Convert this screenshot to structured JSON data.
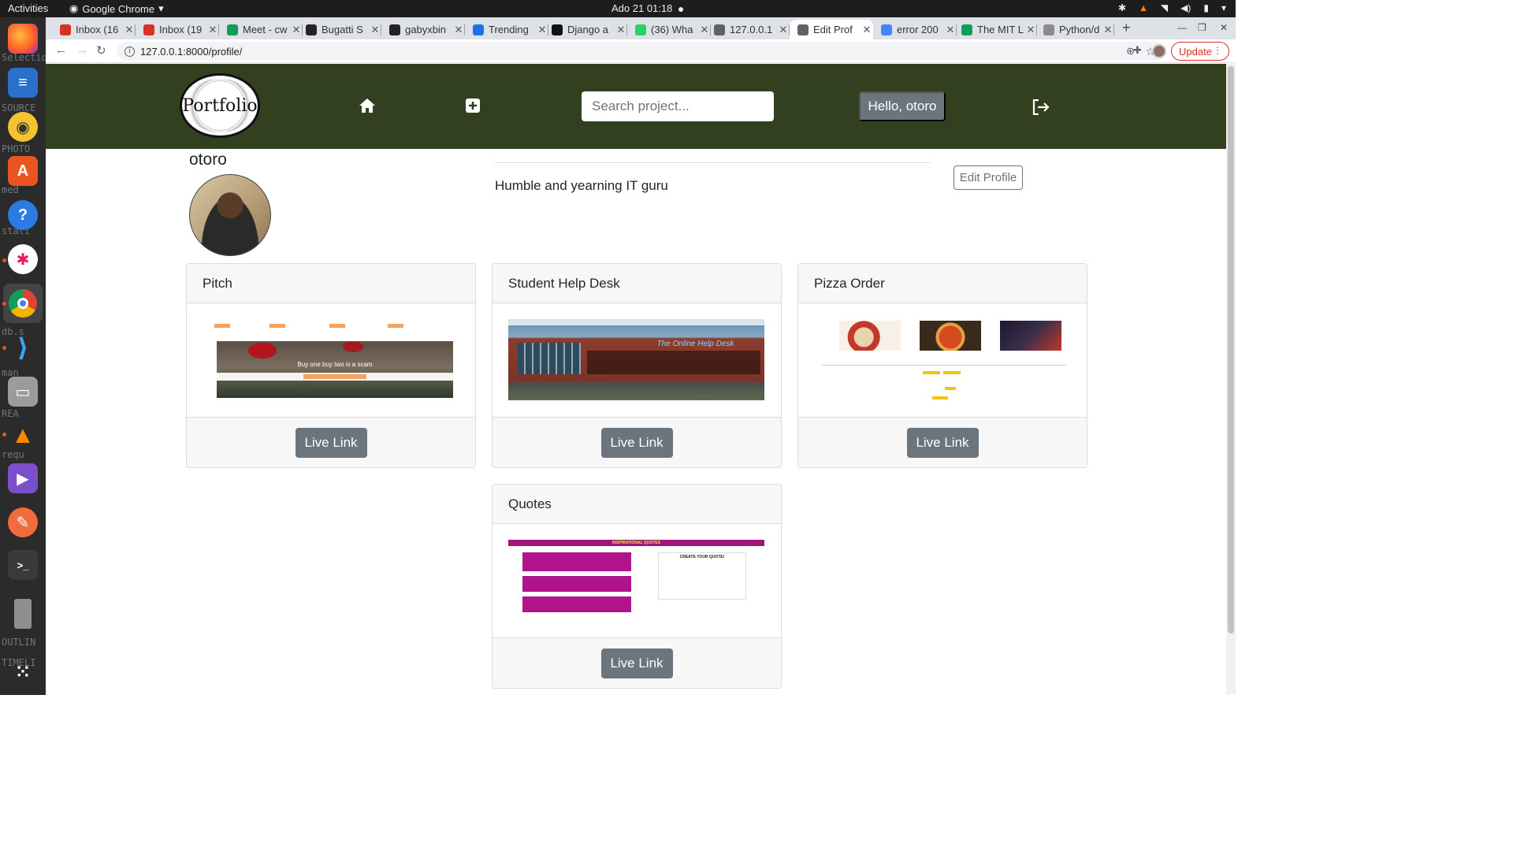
{
  "os": {
    "activities": "Activities",
    "app_name": "Google Chrome",
    "clock": "Ado 21  01:18"
  },
  "dock_ghost_text": [
    "Selection",
    "SOURCE",
    "PHOTO",
    "med",
    "stati",
    "db.s",
    "man",
    "REA",
    "requ",
    "OUTLIN",
    "TIMELI"
  ],
  "browser": {
    "tabs": [
      {
        "title": "Inbox (16",
        "favicon": "gmail-icon",
        "color": "#d93025"
      },
      {
        "title": "Inbox (19",
        "favicon": "gmail-icon",
        "color": "#d93025"
      },
      {
        "title": "Meet - cw",
        "favicon": "meet-icon",
        "color": "#0f9d58"
      },
      {
        "title": "Bugatti S",
        "favicon": "wikipedia-icon",
        "color": "#222222"
      },
      {
        "title": "gabyxbin",
        "favicon": "github-icon",
        "color": "#222222"
      },
      {
        "title": "Trending",
        "favicon": "trending-icon",
        "color": "#1a73e8"
      },
      {
        "title": "Django a",
        "favicon": "django-icon",
        "color": "#111111"
      },
      {
        "title": "(36) Wha",
        "favicon": "whatsapp-icon",
        "color": "#25d366"
      },
      {
        "title": "127.0.0.1",
        "favicon": "globe-icon",
        "color": "#5f6368"
      },
      {
        "title": "Edit Prof",
        "favicon": "globe-icon",
        "color": "#5f6368",
        "active": true
      },
      {
        "title": "error 200",
        "favicon": "google-icon",
        "color": "#4285f4"
      },
      {
        "title": "The MIT L",
        "favicon": "mit-icon",
        "color": "#0f9d58"
      },
      {
        "title": "Python/d",
        "favicon": "python-icon",
        "color": "#8b8b8b"
      }
    ],
    "url": "127.0.0.1:8000/profile/",
    "update_label": "Update"
  },
  "site": {
    "logo_text": "Portfolio",
    "search_placeholder": "Search project...",
    "greeting": "Hello, otoro",
    "username": "otoro",
    "bio": "Humble and yearning IT guru",
    "edit_profile_label": "Edit Profile",
    "projects": [
      {
        "title": "Pitch",
        "link_label": "Live Link",
        "thumb_caption": "Buy one buy two is a scam"
      },
      {
        "title": "Student Help Desk",
        "link_label": "Live Link",
        "thumb_caption": "The Online Help Desk"
      },
      {
        "title": "Pizza Order",
        "link_label": "Live Link"
      },
      {
        "title": "Quotes",
        "link_label": "Live Link",
        "thumb_caption": "INSPIRATIONAL QUOTES",
        "thumb_form_title": "CREATE YOUR QUOTE!"
      }
    ]
  },
  "colors": {
    "navbar": "#33401f",
    "button_secondary": "#6c757d"
  }
}
